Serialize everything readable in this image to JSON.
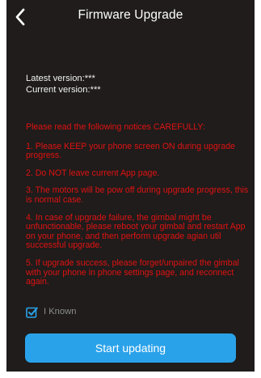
{
  "header": {
    "title": "Firmware Upgrade",
    "back_icon": "chevron-left-icon"
  },
  "versions": {
    "latest": "Latest version:***",
    "current": "Current version:***"
  },
  "notices": {
    "heading": "Please read the following notices CAREFULLY:",
    "items": [
      "1. Please KEEP your phone screen ON during upgrade progress.",
      "2. Do NOT leave current App page.",
      "3. The motors will be pow off during upgrade progress, this is normal case.",
      "4. In case of upgrade failure, the gimbal might be unfunctionable, please reboot your gimbal and restart App on your phone, and then perform upgrade agian util successful upgrade.",
      "5. If upgrade success, please forget/unpaired the gimbal with your phone in phone settings page, and reconnect again."
    ]
  },
  "acknowledge": {
    "label": "I Known",
    "checked": true,
    "icon": "checkbox-checked-icon"
  },
  "start_button": {
    "label": "Start updating"
  },
  "colors": {
    "background": "#1f1c1b",
    "notice_text": "#e01212",
    "accent": "#2aa2ea",
    "muted_text": "#8e8e8e"
  }
}
